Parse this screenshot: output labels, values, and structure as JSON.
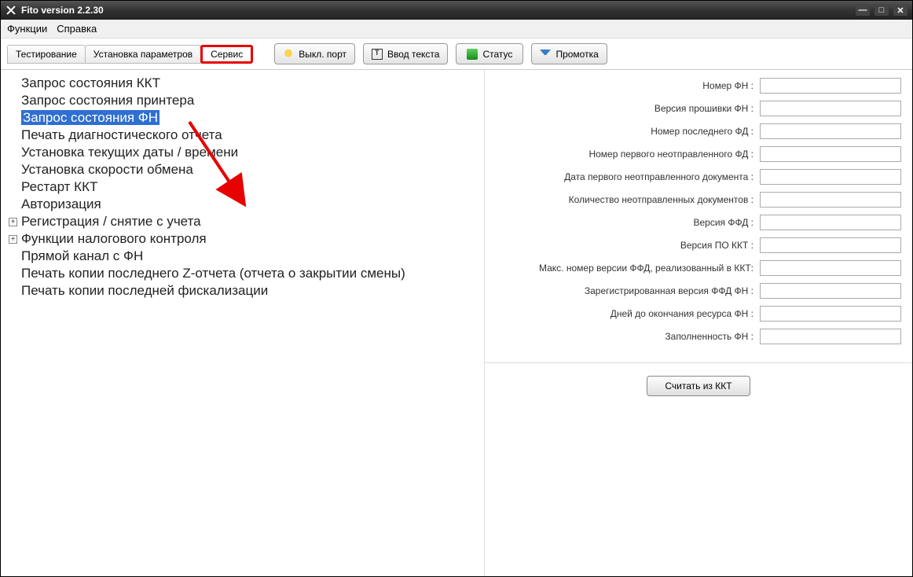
{
  "window": {
    "title": "Fito version 2.2.30"
  },
  "menubar": {
    "functions": "Функции",
    "help": "Справка"
  },
  "tabs": {
    "testing": "Тестирование",
    "params": "Установка параметров",
    "service": "Сервис"
  },
  "toolbar": {
    "port_off": "Выкл. порт",
    "input_text": "Ввод текста",
    "status": "Статус",
    "scroll": "Промотка"
  },
  "tree": {
    "items": [
      "Запрос состояния ККТ",
      "Запрос состояния принтера",
      "Запрос состояния ФН",
      "Печать диагностического отчета",
      "Установка текущих даты / времени",
      "Установка скорости обмена",
      "Рестарт ККТ",
      "Авторизация",
      "Регистрация / снятие с учета",
      "Функции налогового контроля",
      "Прямой канал с ФН",
      "Печать копии последнего Z-отчета (отчета о закрытии смены)",
      "Печать копии последней фискализации"
    ],
    "selected_index": 2,
    "expandable_indices": [
      8,
      9
    ]
  },
  "form": {
    "fields": [
      {
        "label": "Номер ФН :",
        "value": ""
      },
      {
        "label": "Версия прошивки ФН :",
        "value": ""
      },
      {
        "label": "Номер последнего ФД :",
        "value": ""
      },
      {
        "label": "Номер первого неотправленного ФД :",
        "value": ""
      },
      {
        "label": "Дата первого неотправленного документа :",
        "value": ""
      },
      {
        "label": "Количество неотправленных документов :",
        "value": ""
      },
      {
        "label": "Версия ФФД :",
        "value": ""
      },
      {
        "label": "Версия ПО ККТ :",
        "value": ""
      },
      {
        "label": "Макс. номер версии ФФД, реализованный в ККТ:",
        "value": ""
      },
      {
        "label": "Зарегистрированная версия ФФД ФН :",
        "value": ""
      },
      {
        "label": "Дней до окончания ресурса ФН :",
        "value": ""
      },
      {
        "label": "Заполненность ФН :",
        "value": ""
      }
    ]
  },
  "actions": {
    "read_kkt": "Считать из ККТ"
  }
}
